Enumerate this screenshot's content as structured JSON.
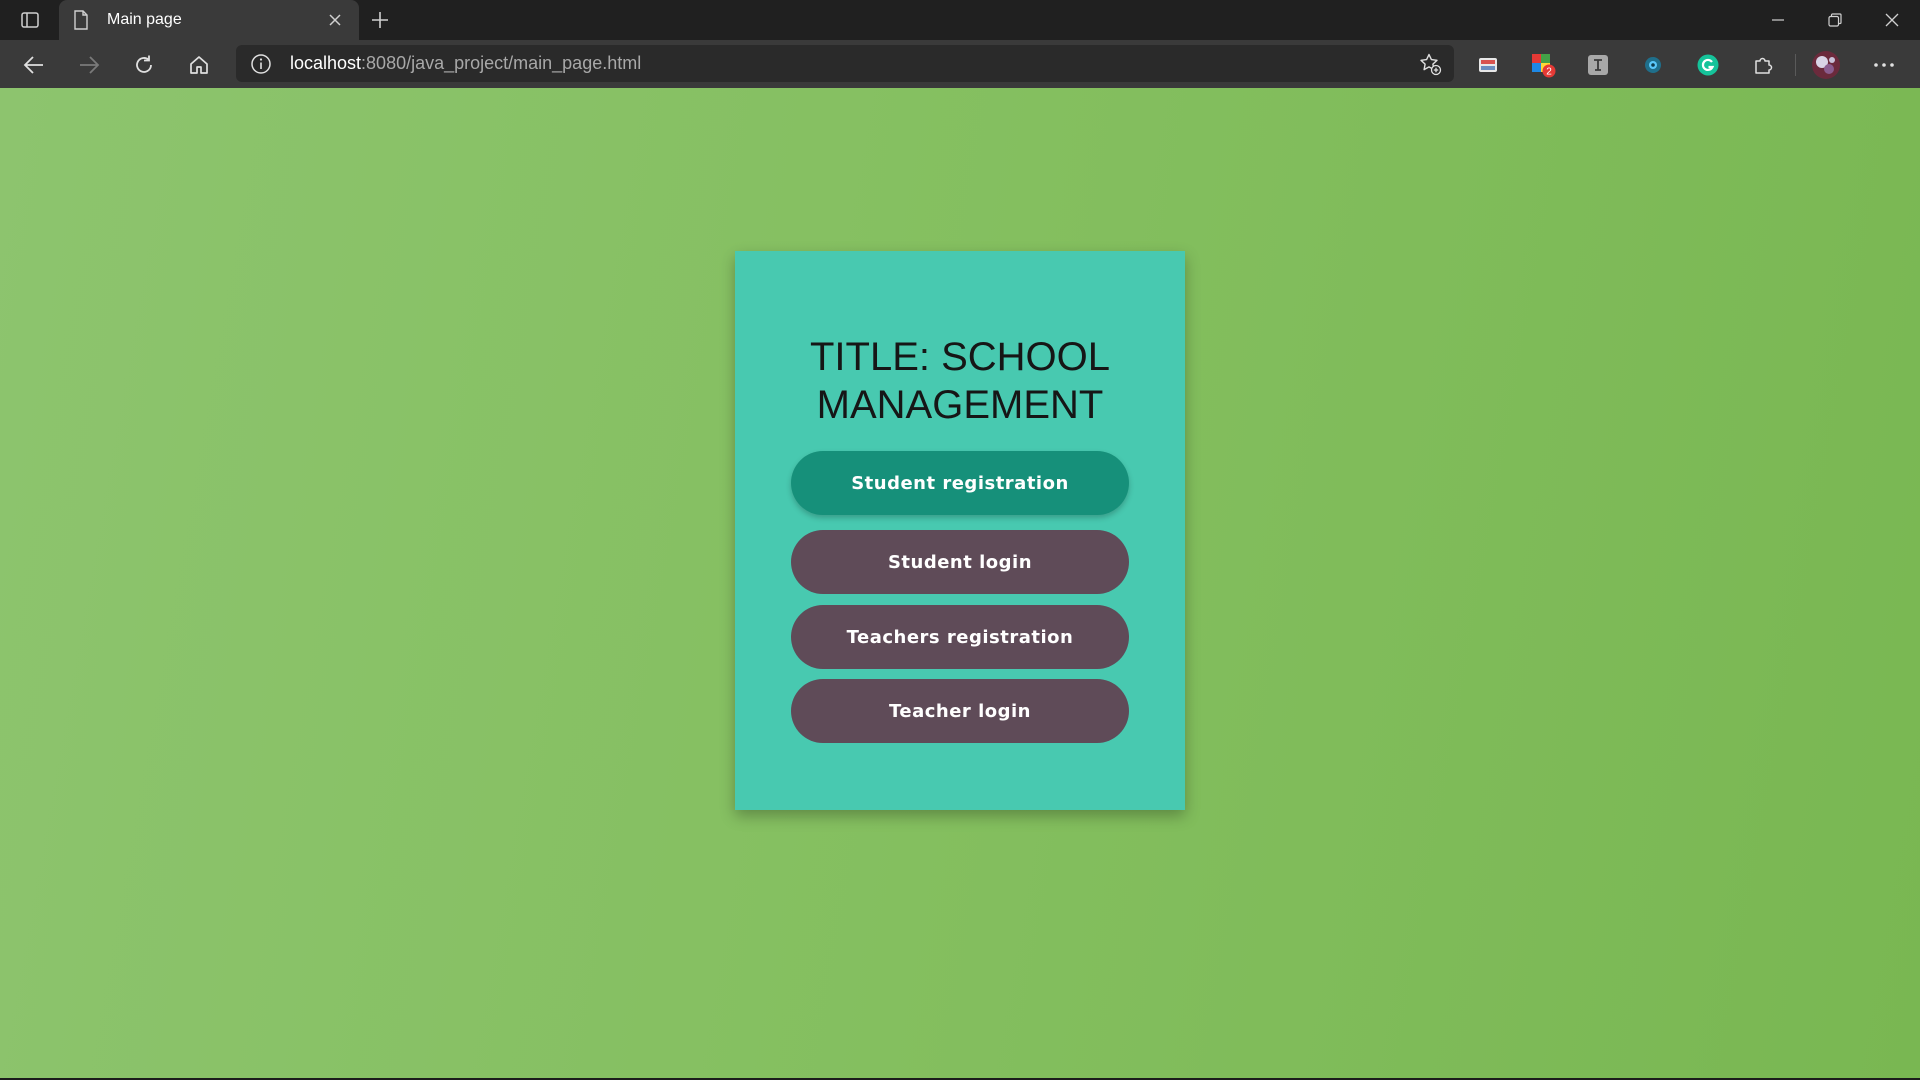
{
  "browser": {
    "tab": {
      "title": "Main page"
    },
    "address_bar": {
      "url_host": "localhost",
      "url_rest": ":8080/java_project/main_page.html"
    },
    "extensions": {
      "badge_count": "2"
    }
  },
  "page": {
    "title": "TITLE: SCHOOL MANAGEMENT",
    "buttons": {
      "student_registration": "Student registration",
      "student_login": "Student login",
      "teachers_registration": "Teachers registration",
      "teacher_login": "Teacher login"
    }
  },
  "colors": {
    "background_green": "#84bf5f",
    "card_teal": "#48c9b0",
    "primary_button": "#16907a",
    "secondary_button": "#5f4b58"
  }
}
